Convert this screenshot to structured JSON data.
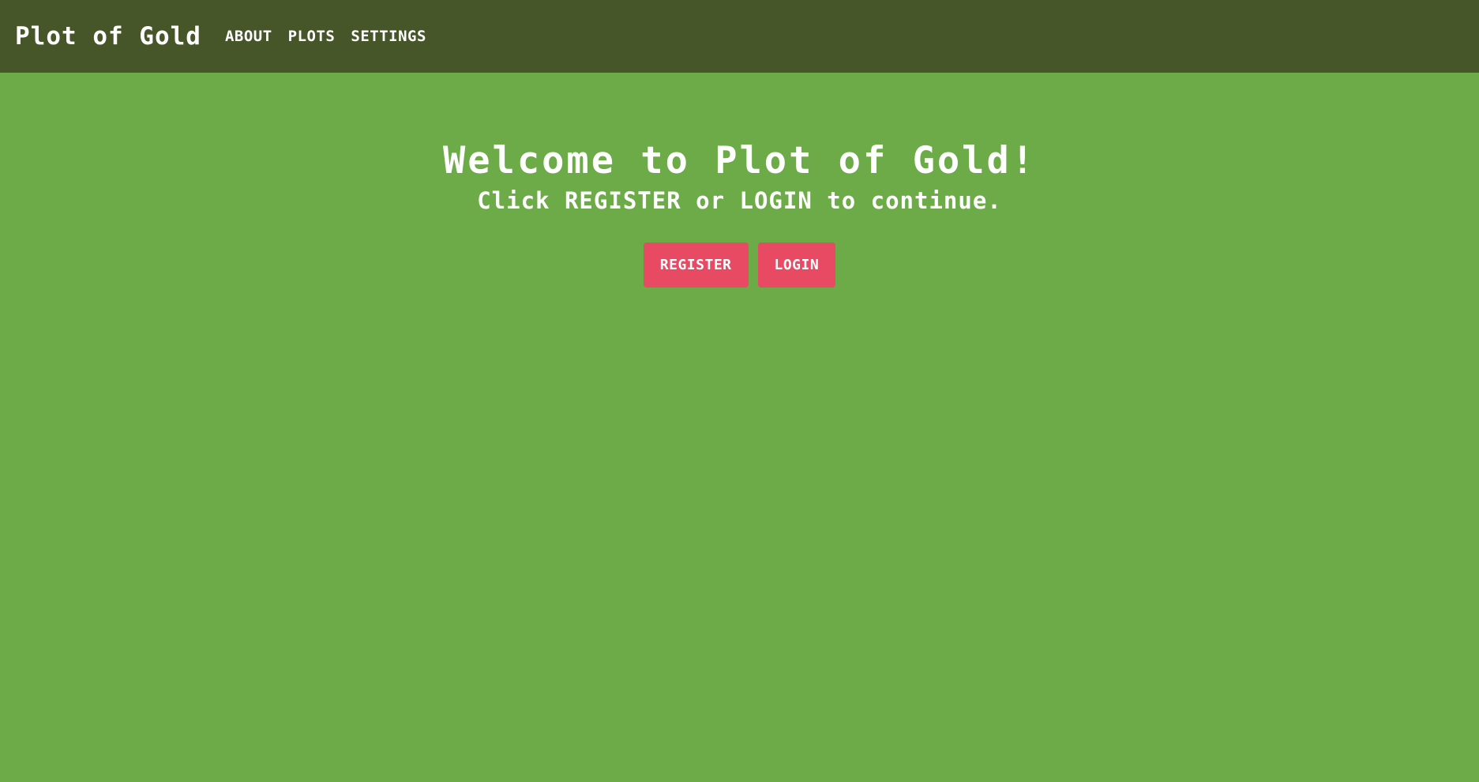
{
  "navbar": {
    "brand": "Plot of Gold",
    "links": [
      {
        "label": "ABOUT"
      },
      {
        "label": "PLOTS"
      },
      {
        "label": "SETTINGS"
      }
    ]
  },
  "hero": {
    "title": "Welcome to Plot of Gold!",
    "subtitle": "Click REGISTER or LOGIN to continue."
  },
  "actions": {
    "register_label": "REGISTER",
    "login_label": "LOGIN"
  },
  "colors": {
    "navbar_bg": "#465628",
    "page_bg": "#6cab47",
    "button_bg": "#e84a63",
    "text": "#ffffff"
  }
}
